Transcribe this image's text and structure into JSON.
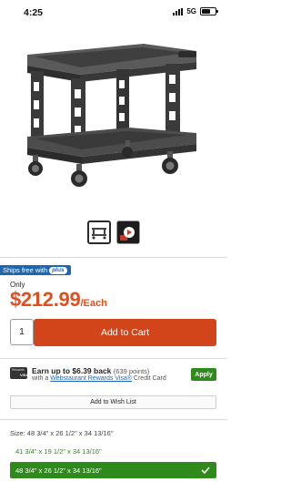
{
  "status_bar": {
    "time": "4:25",
    "network": "5G"
  },
  "product": {
    "image_icon": "utility-cart-image",
    "thumbnails": [
      "cart-thumbnail",
      "video-thumbnail"
    ]
  },
  "shipping": {
    "badge_text": "Ships free with",
    "plus_text": "plus"
  },
  "pricing": {
    "only_label": "Only",
    "price": "$212.99",
    "unit": "/Each"
  },
  "purchase": {
    "quantity": "1",
    "add_to_cart_label": "Add to Cart"
  },
  "rewards": {
    "title": "Earn up to $6.39 back",
    "points": "(639 points)",
    "sub_prefix": "with a",
    "card_link": "Webstaurant Rewards Visa®",
    "sub_suffix": "Credit Card",
    "apply_label": "Apply",
    "card_text": "Rewards",
    "card_brand": "VISA"
  },
  "wishlist": {
    "label": "Add to Wish List"
  },
  "size": {
    "label_prefix": "Size:",
    "selected_value": "48 3/4\" x 26 1/2\" x 34 13/16\"",
    "options": [
      {
        "label": "41 3/4\" x 19 1/2\" x 34 13/16\"",
        "selected": false
      },
      {
        "label": "48 3/4\" x 26 1/2\" x 34 13/16\"",
        "selected": true
      }
    ]
  },
  "colors": {
    "accent_orange": "#d2441a",
    "price_orange": "#e0501e",
    "green": "#2f8a1c",
    "blue": "#1e67b0"
  }
}
